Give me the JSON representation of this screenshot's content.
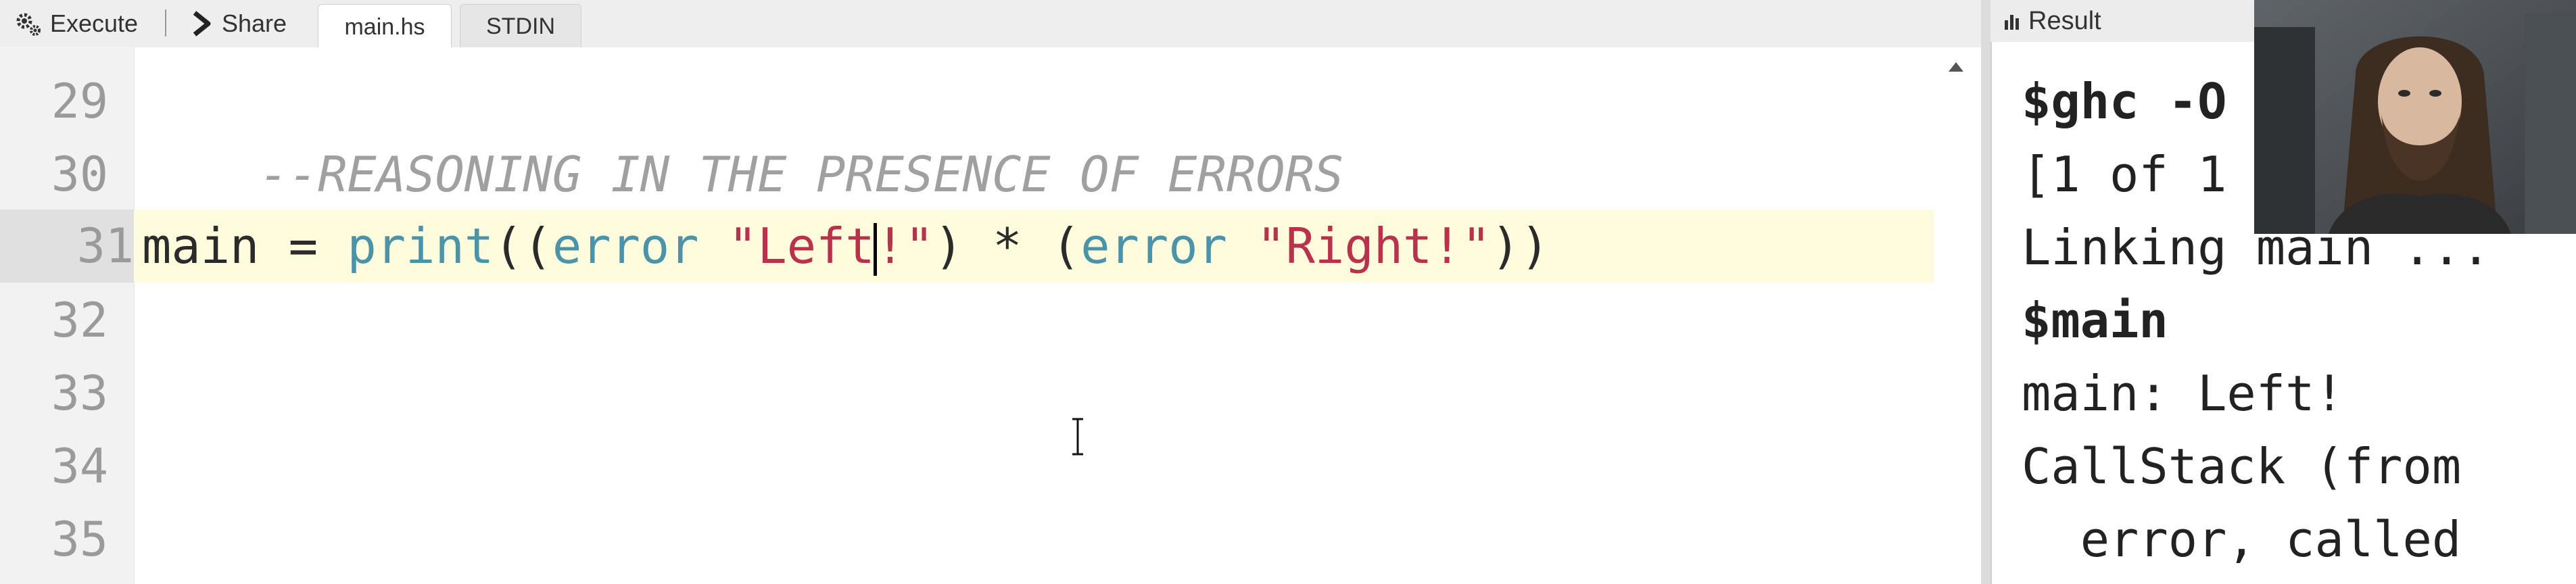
{
  "toolbar": {
    "execute_label": "Execute",
    "share_label": "Share",
    "tabs": [
      {
        "label": "main.hs",
        "active": true
      },
      {
        "label": "STDIN",
        "active": false
      }
    ]
  },
  "editor": {
    "lines": [
      {
        "number": "29",
        "text": "--REASONING IN THE PRESENCE OF ERRORS"
      },
      {
        "number": "30",
        "text": ""
      },
      {
        "number": "31",
        "text": "main = print((error \"Left!\") * (error \"Right!\"))",
        "active": true
      },
      {
        "number": "32",
        "text": ""
      },
      {
        "number": "33",
        "text": ""
      },
      {
        "number": "34",
        "text": ""
      },
      {
        "number": "35",
        "text": ""
      }
    ],
    "tokens_line_31": {
      "t1": "main",
      "t2": " = ",
      "t3": "print",
      "t4": "((",
      "t5": "error",
      "t6": " ",
      "t7": "\"Left",
      "t8": "!\"",
      "t9": ") * (",
      "t10": "error",
      "t11": " ",
      "t12": "\"Right!\"",
      "t13": "))"
    }
  },
  "result": {
    "header_label": "Result",
    "lines": [
      {
        "text": "$ghc -O",
        "cmd": true
      },
      {
        "text": "[1 of 1",
        "cmd": false
      },
      {
        "text": "Linking main ...",
        "cmd": false
      },
      {
        "text": "$main",
        "cmd": true
      },
      {
        "text": "main: Left!",
        "cmd": false
      },
      {
        "text": "CallStack (from",
        "cmd": false
      },
      {
        "text": "  error, called",
        "cmd": false
      }
    ]
  },
  "colors": {
    "comment": "#a0a0a0",
    "builtin": "#4a93a8",
    "string": "#b7324a",
    "active_line": "#fffbdd"
  },
  "icons": {
    "execute": "gears-icon",
    "share": "chevron-right-icon",
    "result": "bar-chart-icon",
    "ibeam": "text-cursor-icon"
  }
}
